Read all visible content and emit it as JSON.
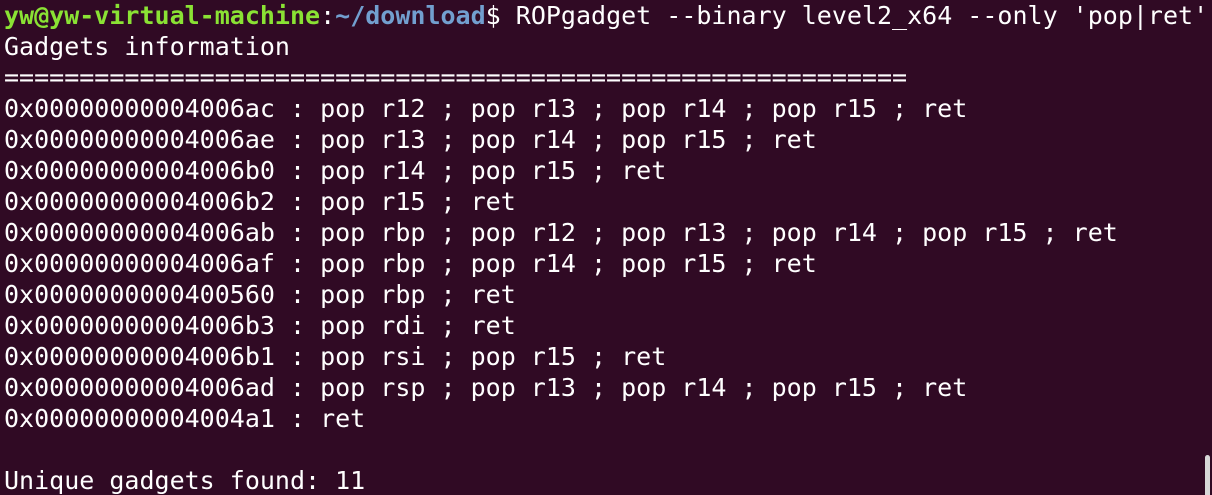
{
  "prompt": {
    "user_host": "yw@yw-virtual-machine",
    "separator": ":",
    "path": "~/download",
    "dollar": "$",
    "command": " ROPgadget --binary level2_x64 --only 'pop|ret'"
  },
  "output": {
    "header": "Gadgets information",
    "divider": "============================================================",
    "gadgets": [
      "0x00000000004006ac : pop r12 ; pop r13 ; pop r14 ; pop r15 ; ret",
      "0x00000000004006ae : pop r13 ; pop r14 ; pop r15 ; ret",
      "0x00000000004006b0 : pop r14 ; pop r15 ; ret",
      "0x00000000004006b2 : pop r15 ; ret",
      "0x00000000004006ab : pop rbp ; pop r12 ; pop r13 ; pop r14 ; pop r15 ; ret",
      "0x00000000004006af : pop rbp ; pop r14 ; pop r15 ; ret",
      "0x0000000000400560 : pop rbp ; ret",
      "0x00000000004006b3 : pop rdi ; ret",
      "0x00000000004006b1 : pop rsi ; pop r15 ; ret",
      "0x00000000004006ad : pop rsp ; pop r13 ; pop r14 ; pop r15 ; ret",
      "0x00000000004004a1 : ret"
    ],
    "blank": "",
    "summary": "Unique gadgets found: 11"
  },
  "colors": {
    "background": "#300a24",
    "text": "#ffffff",
    "user_host": "#8ae234",
    "path": "#729fcf"
  }
}
